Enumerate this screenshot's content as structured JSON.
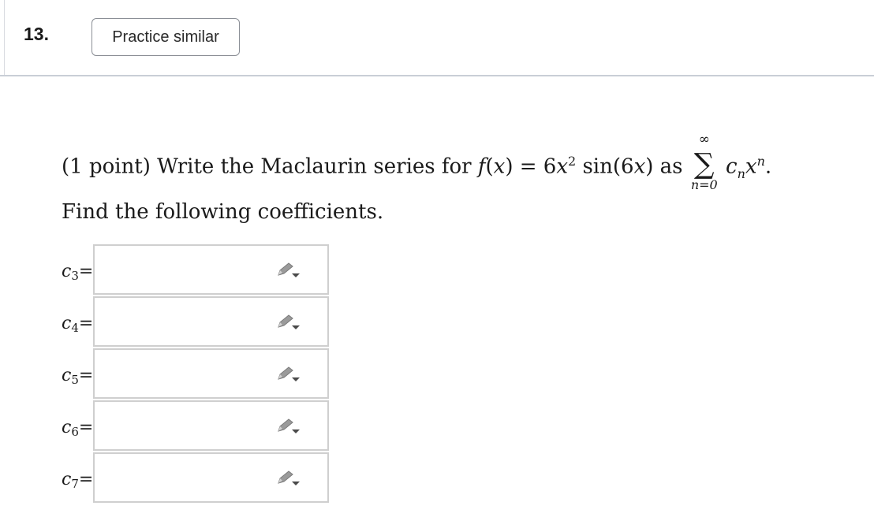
{
  "header": {
    "question_number": "13.",
    "practice_label": "Practice similar"
  },
  "problem": {
    "prefix": "(1 point) Write the Maclaurin series for",
    "f": "f",
    "x_var": "x",
    "paren_open": "(",
    "paren_close": ")",
    "equals": "=",
    "coef": "6",
    "exp2": "2",
    "sin": "sin",
    "arg": "6",
    "as": "as",
    "sigma": "∑",
    "sum_upper": "∞",
    "sum_lower": "n=0",
    "c": "c",
    "n": "n",
    "period": "."
  },
  "instruction": "Find the following coefficients.",
  "answers": [
    {
      "var": "c",
      "sub": "3",
      "eq": "=",
      "value": "",
      "icon": "pencil-dropdown-icon"
    },
    {
      "var": "c",
      "sub": "4",
      "eq": "=",
      "value": "",
      "icon": "pencil-dropdown-icon"
    },
    {
      "var": "c",
      "sub": "5",
      "eq": "=",
      "value": "",
      "icon": "pencil-dropdown-icon"
    },
    {
      "var": "c",
      "sub": "6",
      "eq": "=",
      "value": "",
      "icon": "pencil-dropdown-icon"
    },
    {
      "var": "c",
      "sub": "7",
      "eq": "=",
      "value": "",
      "icon": "pencil-dropdown-icon"
    }
  ]
}
